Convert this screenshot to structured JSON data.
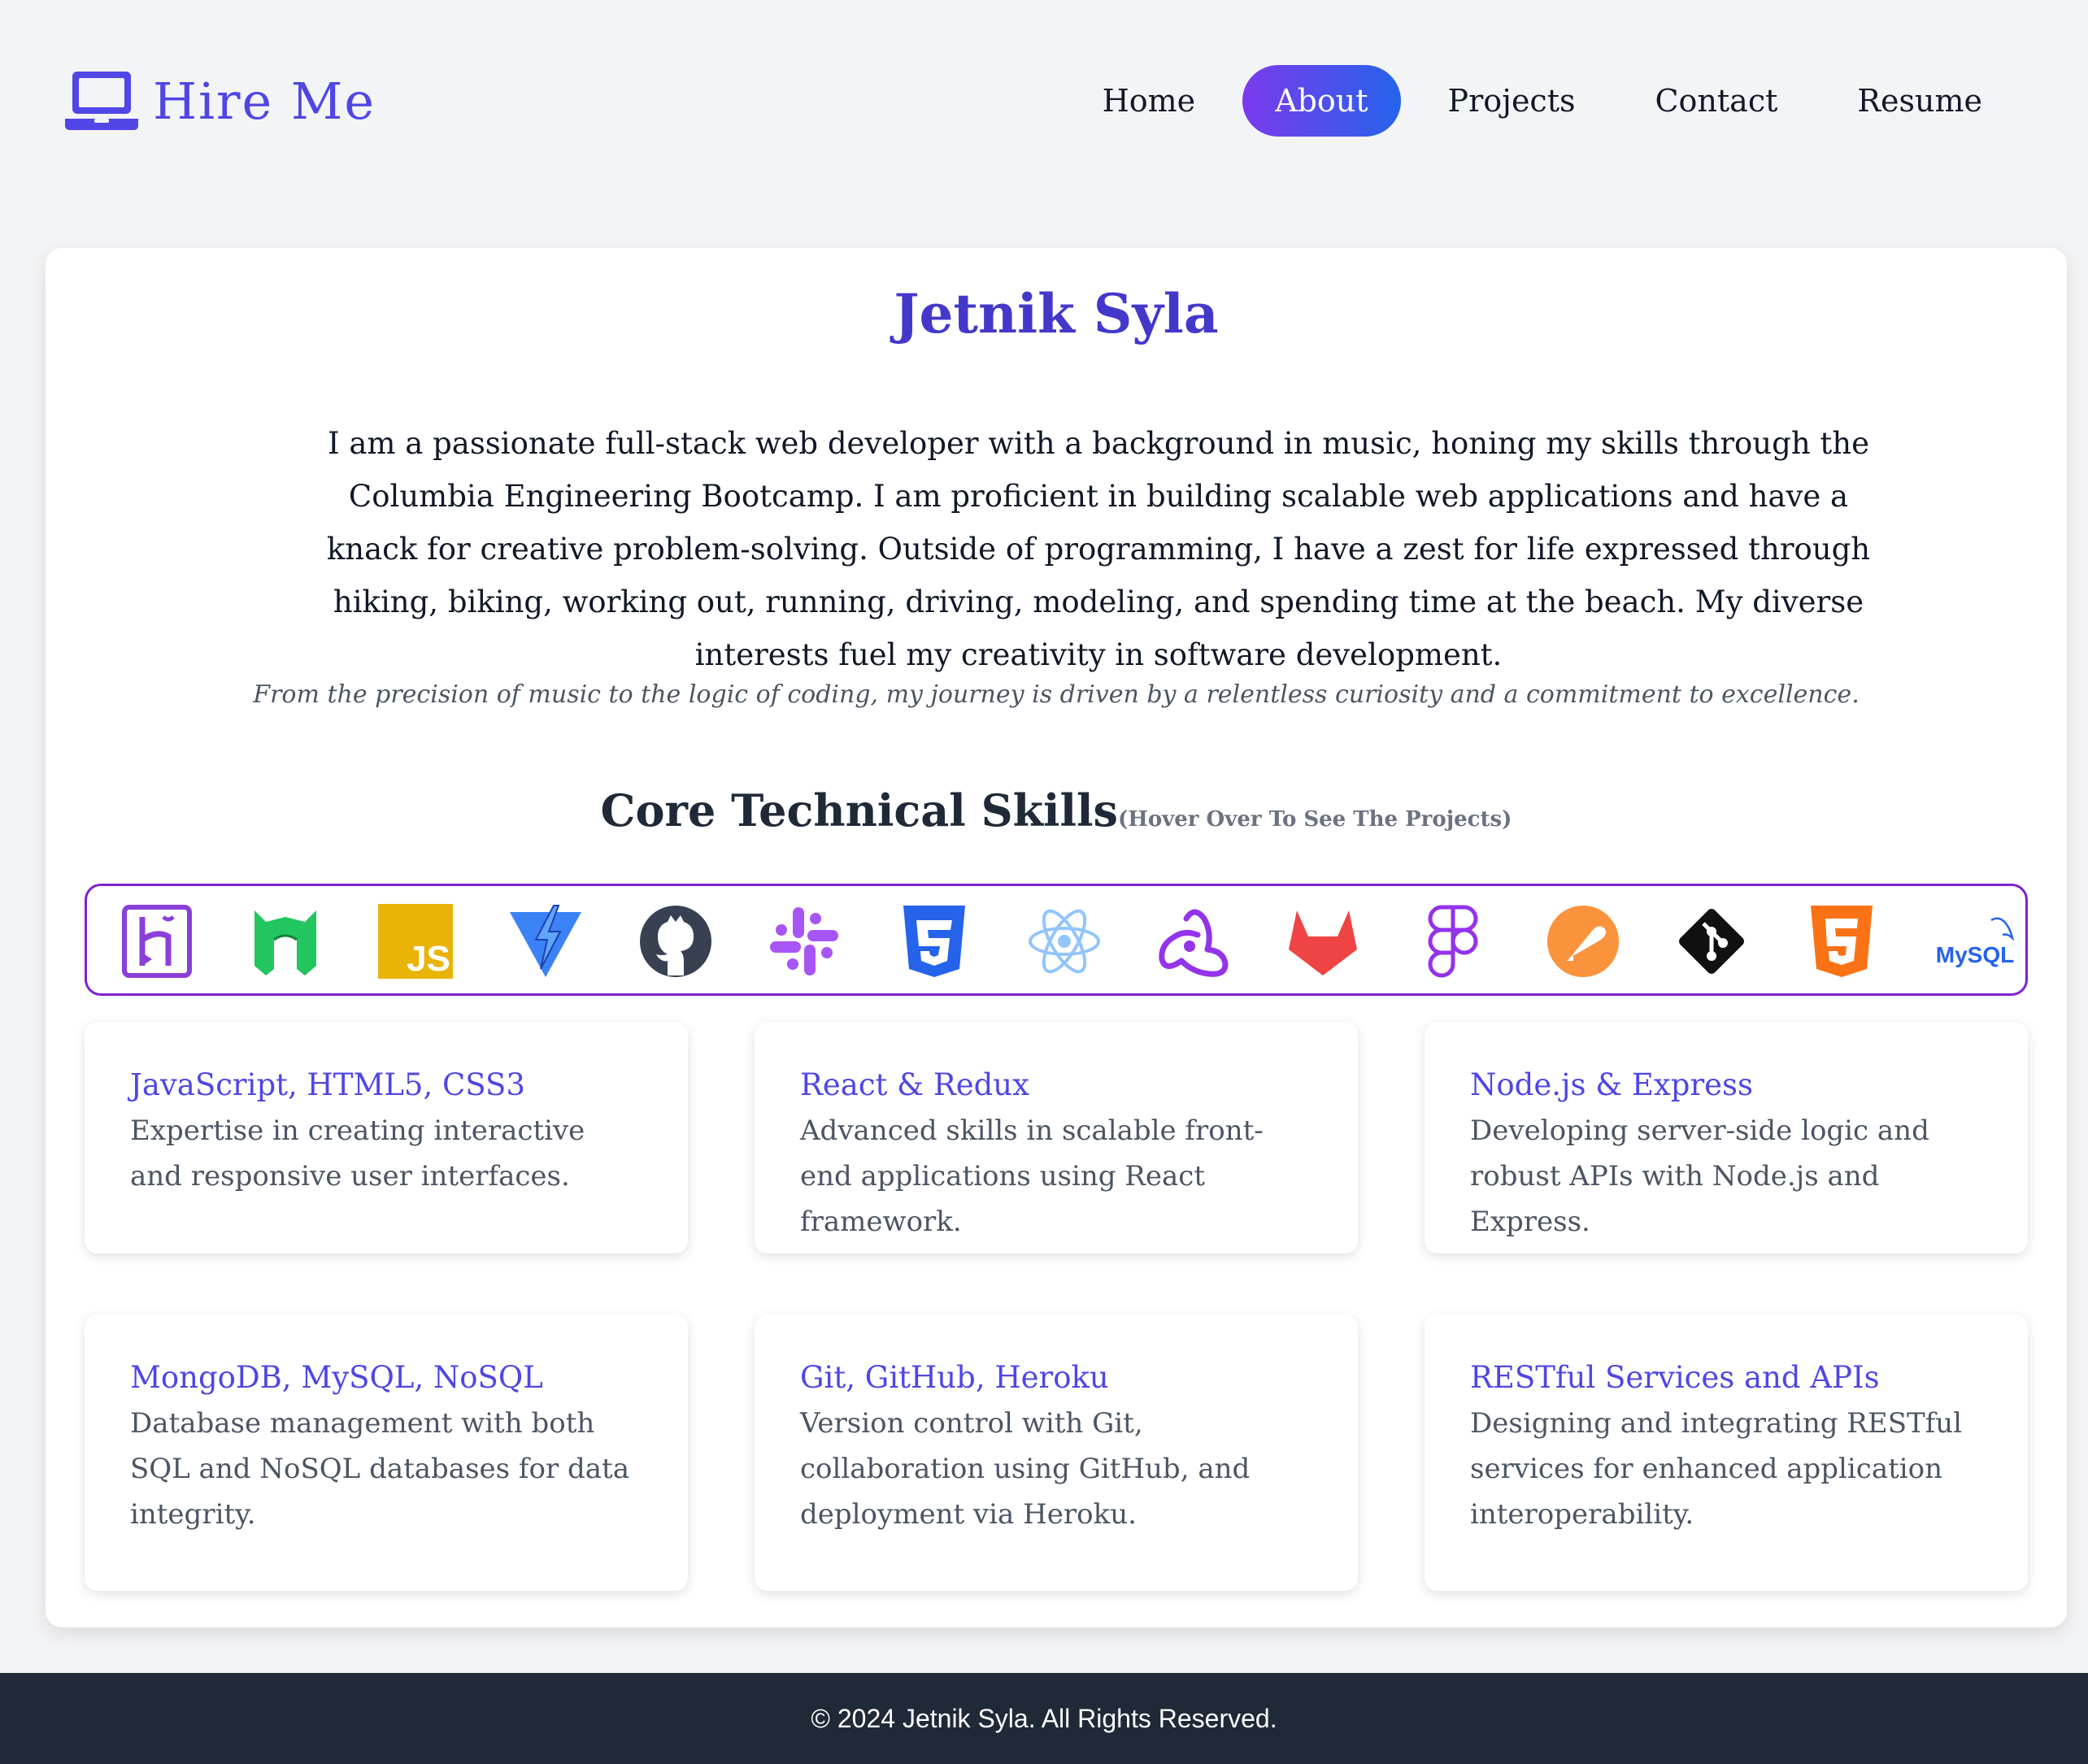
{
  "header": {
    "logo_text": "Hire Me",
    "logo_icon": "laptop-icon",
    "nav": [
      {
        "label": "Home",
        "active": false
      },
      {
        "label": "About",
        "active": true
      },
      {
        "label": "Projects",
        "active": false
      },
      {
        "label": "Contact",
        "active": false
      },
      {
        "label": "Resume",
        "active": false
      }
    ]
  },
  "about": {
    "name": "Jetnik Syla",
    "bio": "I am a passionate full-stack web developer with a background in music, honing my skills through the Columbia Engineering Bootcamp. I am proficient in building scalable web applications and have a knack for creative problem-solving. Outside of programming, I have a zest for life expressed through hiking, biking, working out, running, driving, modeling, and spending time at the beach. My diverse interests fuel my creativity in software development.",
    "tagline": "From the precision of music to the logic of coding, my journey is driven by a relentless curiosity and a commitment to excellence."
  },
  "skills": {
    "title": "Core Technical Skills",
    "hint": "(Hover Over To See The Projects)",
    "icons": [
      "heroku-icon",
      "nodemon-icon",
      "javascript-icon",
      "vite-icon",
      "github-icon",
      "slack-icon",
      "css3-icon",
      "react-icon",
      "redux-icon",
      "gitlab-icon",
      "figma-icon",
      "postman-icon",
      "git-icon",
      "html5-icon",
      "mysql-icon"
    ],
    "mysql_logo_text": "MySQL",
    "js_logo_text": "JS",
    "cards": [
      {
        "title": "JavaScript, HTML5, CSS3",
        "desc": "Expertise in creating interactive and responsive user interfaces."
      },
      {
        "title": "React & Redux",
        "desc": "Advanced skills in scalable front-end applications using React framework."
      },
      {
        "title": "Node.js & Express",
        "desc": "Developing server-side logic and robust APIs with Node.js and Express."
      },
      {
        "title": "MongoDB, MySQL, NoSQL",
        "desc": "Database management with both SQL and NoSQL databases for data integrity."
      },
      {
        "title": "Git, GitHub, Heroku",
        "desc": "Version control with Git, collaboration using GitHub, and deployment via Heroku."
      },
      {
        "title": "RESTful Services and APIs",
        "desc": "Designing and integrating RESTful services for enhanced application interoperability."
      }
    ]
  },
  "footer": {
    "text": "© 2024 Jetnik Syla. All Rights Reserved."
  },
  "colors": {
    "accent": "#4f46e5",
    "nav_gradient_start": "#7c3aed",
    "nav_gradient_end": "#2563eb",
    "strip_border": "#7e22ce",
    "footer_bg": "#1f2937"
  }
}
